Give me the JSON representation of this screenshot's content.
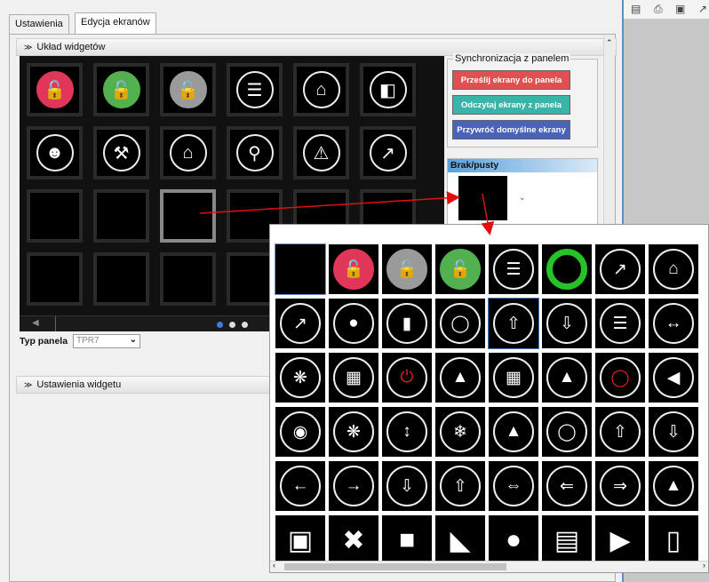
{
  "tabs": [
    "Ustawienia",
    "Edycja ekranów"
  ],
  "sections": {
    "layout_title": "Układ widgetów",
    "widget_settings_title": "Ustawienia widgetu"
  },
  "sync": {
    "legend": "Synchronizacja z panelem",
    "send_label": "Prześlij ekrany do panela",
    "read_label": "Odczytaj ekrany z panela",
    "restore_label": "Przywróć domyślne ekrany",
    "colors": {
      "send": "#e05050",
      "read": "#3ab3a8",
      "restore": "#4a63b8"
    }
  },
  "selected_widget": {
    "label": "Brak/pusty"
  },
  "panel_type": {
    "label": "Typ panela",
    "value": "TPR7"
  },
  "grid": {
    "rows": [
      [
        "lock-red",
        "lock-green",
        "lock-gray",
        "list-bulb",
        "home-search",
        "document-search"
      ],
      [
        "users",
        "tools",
        "home-shutter",
        "file-search",
        "warning",
        "chart-ai"
      ],
      [
        "",
        "",
        "",
        "",
        "",
        ""
      ],
      [
        "",
        "",
        "",
        "",
        "",
        ""
      ]
    ],
    "page_count": 3,
    "active_page": 1
  },
  "gallery": {
    "rows": [
      [
        "empty",
        "lock-red",
        "lock-gray",
        "lock-green",
        "list-bulb",
        "ring-green",
        "chart-temp",
        "home-search"
      ],
      [
        "chart-ai",
        "toggle-off",
        "switch",
        "bulb",
        "blind-up",
        "blind-down",
        "blinds",
        "gate"
      ],
      [
        "fan",
        "heater",
        "power-red",
        "fountain",
        "radiator",
        "lamp-post",
        "socket-red",
        "play-left"
      ],
      [
        "spray",
        "fan-small",
        "blind-updown",
        "ac-unit",
        "ceiling-lamp",
        "washer",
        "barrier-up",
        "barrier-down"
      ],
      [
        "gate-left",
        "gate-right",
        "garage-down",
        "garage-up",
        "slide-both",
        "slide-left",
        "slide-right",
        "floor-lamp"
      ],
      [
        "fireplace",
        "cutlery",
        "bath",
        "stairs",
        "teddy",
        "living-room",
        "treadmill",
        "fridge"
      ]
    ]
  },
  "titlebar_icons": [
    "save-icon",
    "print-icon",
    "copy-icon"
  ]
}
